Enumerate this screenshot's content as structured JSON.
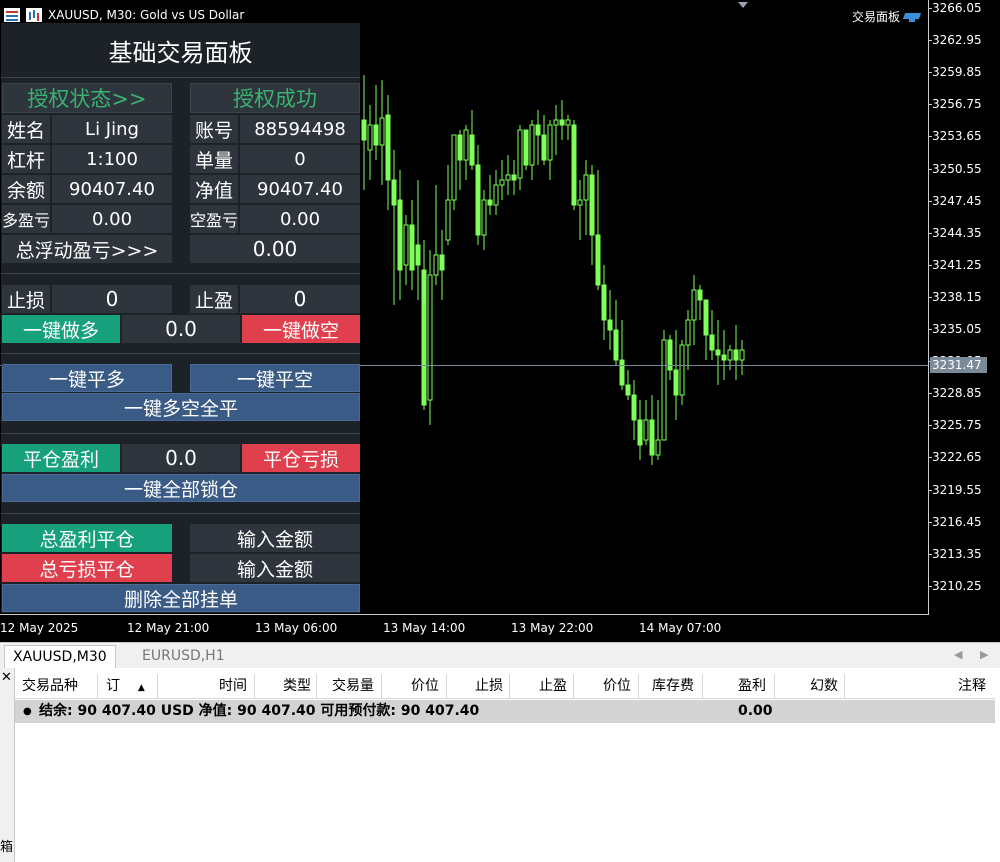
{
  "chart": {
    "header_title": "XAUUSD, M30:  Gold vs US Dollar",
    "panel_tag": "交易面板",
    "current_price": "3231.47",
    "price_labels": [
      "3266.05",
      "3262.95",
      "3259.85",
      "3256.75",
      "3253.65",
      "3250.55",
      "3247.45",
      "3244.35",
      "3241.25",
      "3238.15",
      "3235.05",
      "3231.95",
      "3228.85",
      "3225.75",
      "3222.65",
      "3219.55",
      "3216.45",
      "3213.35",
      "3210.25"
    ],
    "time_labels": [
      "12 May 2025",
      "12 May 21:00",
      "13 May 06:00",
      "13 May 14:00",
      "13 May 22:00",
      "14 May 07:00"
    ],
    "up_color": "#7fff5a",
    "down_color": "#000000",
    "wick_color": "#7fff5a"
  },
  "panel": {
    "title": "基础交易面板",
    "auth_state_label": "授权状态>>",
    "auth_ok_label": "授权成功",
    "rows": [
      {
        "l1": "姓名",
        "v1": "Li Jing",
        "l2": "账号",
        "v2": "88594498"
      },
      {
        "l1": "杠杆",
        "v1": "1:100",
        "l2": "单量",
        "v2": "0"
      },
      {
        "l1": "余额",
        "v1": "90407.40",
        "l2": "净值",
        "v2": "90407.40"
      },
      {
        "l1": "多盈亏",
        "v1": "0.00",
        "l2": "空盈亏",
        "v2": "0.00"
      }
    ],
    "total_float_label": "总浮动盈亏>>>",
    "total_float_value": "0.00",
    "sl_label": "止损",
    "sl_value": "0",
    "tp_label": "止盈",
    "tp_value": "0",
    "buy_btn": "一键做多",
    "lot_value": "0.0",
    "sell_btn": "一键做空",
    "close_long": "一键平多",
    "close_short": "一键平空",
    "close_all": "一键多空全平",
    "close_profit": "平仓盈利",
    "close_mid_value": "0.0",
    "close_loss": "平仓亏损",
    "lock_all": "一键全部锁仓",
    "total_profit_close": "总盈利平仓",
    "input_amount_1": "输入金额",
    "total_loss_close": "总亏损平仓",
    "input_amount_2": "输入金额",
    "delete_pending": "删除全部挂单",
    "colors": {
      "green": "#16a07b",
      "red": "#e0404e",
      "blue": "#3b5b87",
      "dark": "#2f353c"
    }
  },
  "tabs": [
    {
      "label": "XAUUSD,M30",
      "active": true
    },
    {
      "label": "EURUSD,H1",
      "active": false
    }
  ],
  "terminal": {
    "columns": [
      "交易品种",
      "订",
      "时间",
      "类型",
      "交易量",
      "价位",
      "止损",
      "止盈",
      "价位",
      "库存费",
      "盈利",
      "幻数",
      "注释"
    ],
    "summary_text": "结余: 90 407.40 USD  净值: 90 407.40  可用预付款: 90 407.40",
    "summary_profit": "0.00",
    "side_label": "箱"
  }
}
